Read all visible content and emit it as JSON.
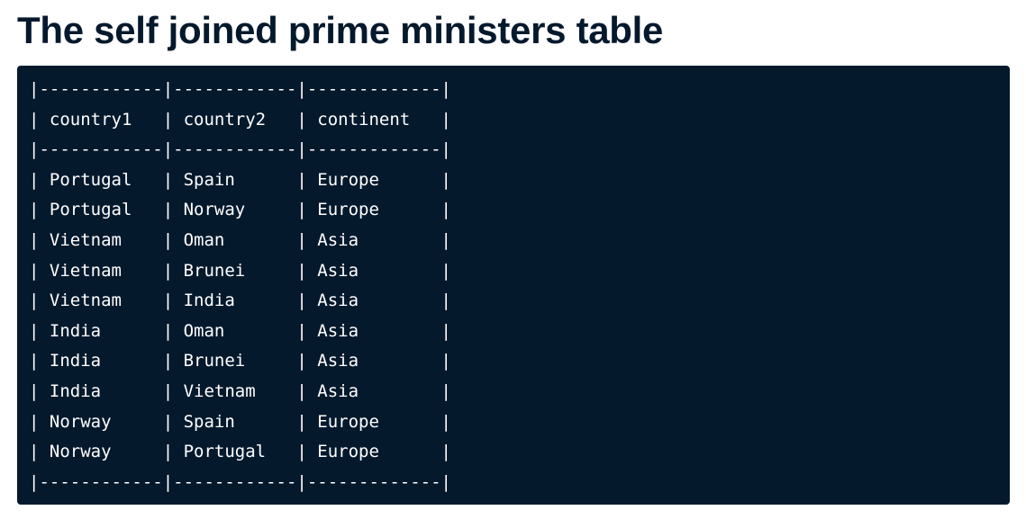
{
  "title": "The self joined prime ministers table",
  "table_text": {
    "lines": [
      "|------------|------------|-------------|",
      "| country1   | country2   | continent   |",
      "|------------|------------|-------------|",
      "| Portugal   | Spain      | Europe      |",
      "| Portugal   | Norway     | Europe      |",
      "| Vietnam    | Oman       | Asia        |",
      "| Vietnam    | Brunei     | Asia        |",
      "| Vietnam    | India      | Asia        |",
      "| India      | Oman       | Asia        |",
      "| India      | Brunei     | Asia        |",
      "| India      | Vietnam    | Asia        |",
      "| Norway     | Spain      | Europe      |",
      "| Norway     | Portugal   | Europe      |",
      "|------------|------------|-------------|"
    ]
  },
  "colors": {
    "title_text": "#05192d",
    "code_background": "#05192d",
    "code_text": "#ffffff"
  }
}
